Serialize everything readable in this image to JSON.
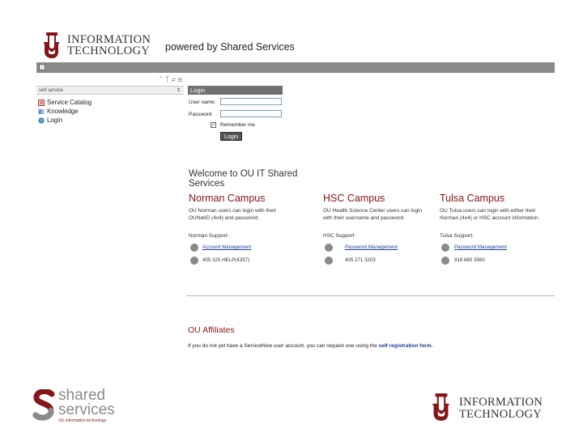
{
  "header": {
    "logo_line1": "INFORMATION",
    "logo_line2": "TECHNOLOGY",
    "powered_by": "powered by Shared Services"
  },
  "sidebar": {
    "search_label": "self service",
    "items": [
      {
        "label": "Service Catalog",
        "icon": "catalog-icon"
      },
      {
        "label": "Knowledge",
        "icon": "knowledge-icon"
      },
      {
        "label": "Login",
        "icon": "globe-icon"
      }
    ]
  },
  "login": {
    "header": "Login",
    "username_label": "User name:",
    "password_label": "Password",
    "remember_label": "Remember me",
    "remember_checked": true,
    "button_label": "Login"
  },
  "welcome": {
    "title": "Welcome to OU IT Shared Services"
  },
  "campuses": [
    {
      "name": "Norman Campus",
      "description": "OU Norman users can login with their OUNetID (4x4) and password.",
      "support_label": "Norman Support:",
      "link_label": "Account Management",
      "phone": "405 325 HELP(4357)"
    },
    {
      "name": "HSC Campus",
      "description": "OU Health Science Center users can login with their username and password.",
      "support_label": "HSC Support:",
      "link_label": "Password Management",
      "phone": "405 271 3203"
    },
    {
      "name": "Tulsa Campus",
      "description": "OU Tulsa users can login with either their Norman (4x4) or HSC account information.",
      "support_label": "Tulsa Support:",
      "link_label": "Password Management",
      "phone": "918 660 3560"
    }
  ],
  "affiliates": {
    "title": "OU Affiliates",
    "text": "If you do not yet have a ServiceNow user account, you can request one using the",
    "link": "self registration form."
  },
  "footer": {
    "shared_line1": "shared",
    "shared_line2": "services",
    "shared_sub": "OU information technology",
    "logo_line1": "INFORMATION",
    "logo_line2": "TECHNOLOGY"
  },
  "colors": {
    "ou_crimson": "#841617",
    "link_blue": "#1a3e9a",
    "toolbar_gray": "#8a8a8a"
  }
}
